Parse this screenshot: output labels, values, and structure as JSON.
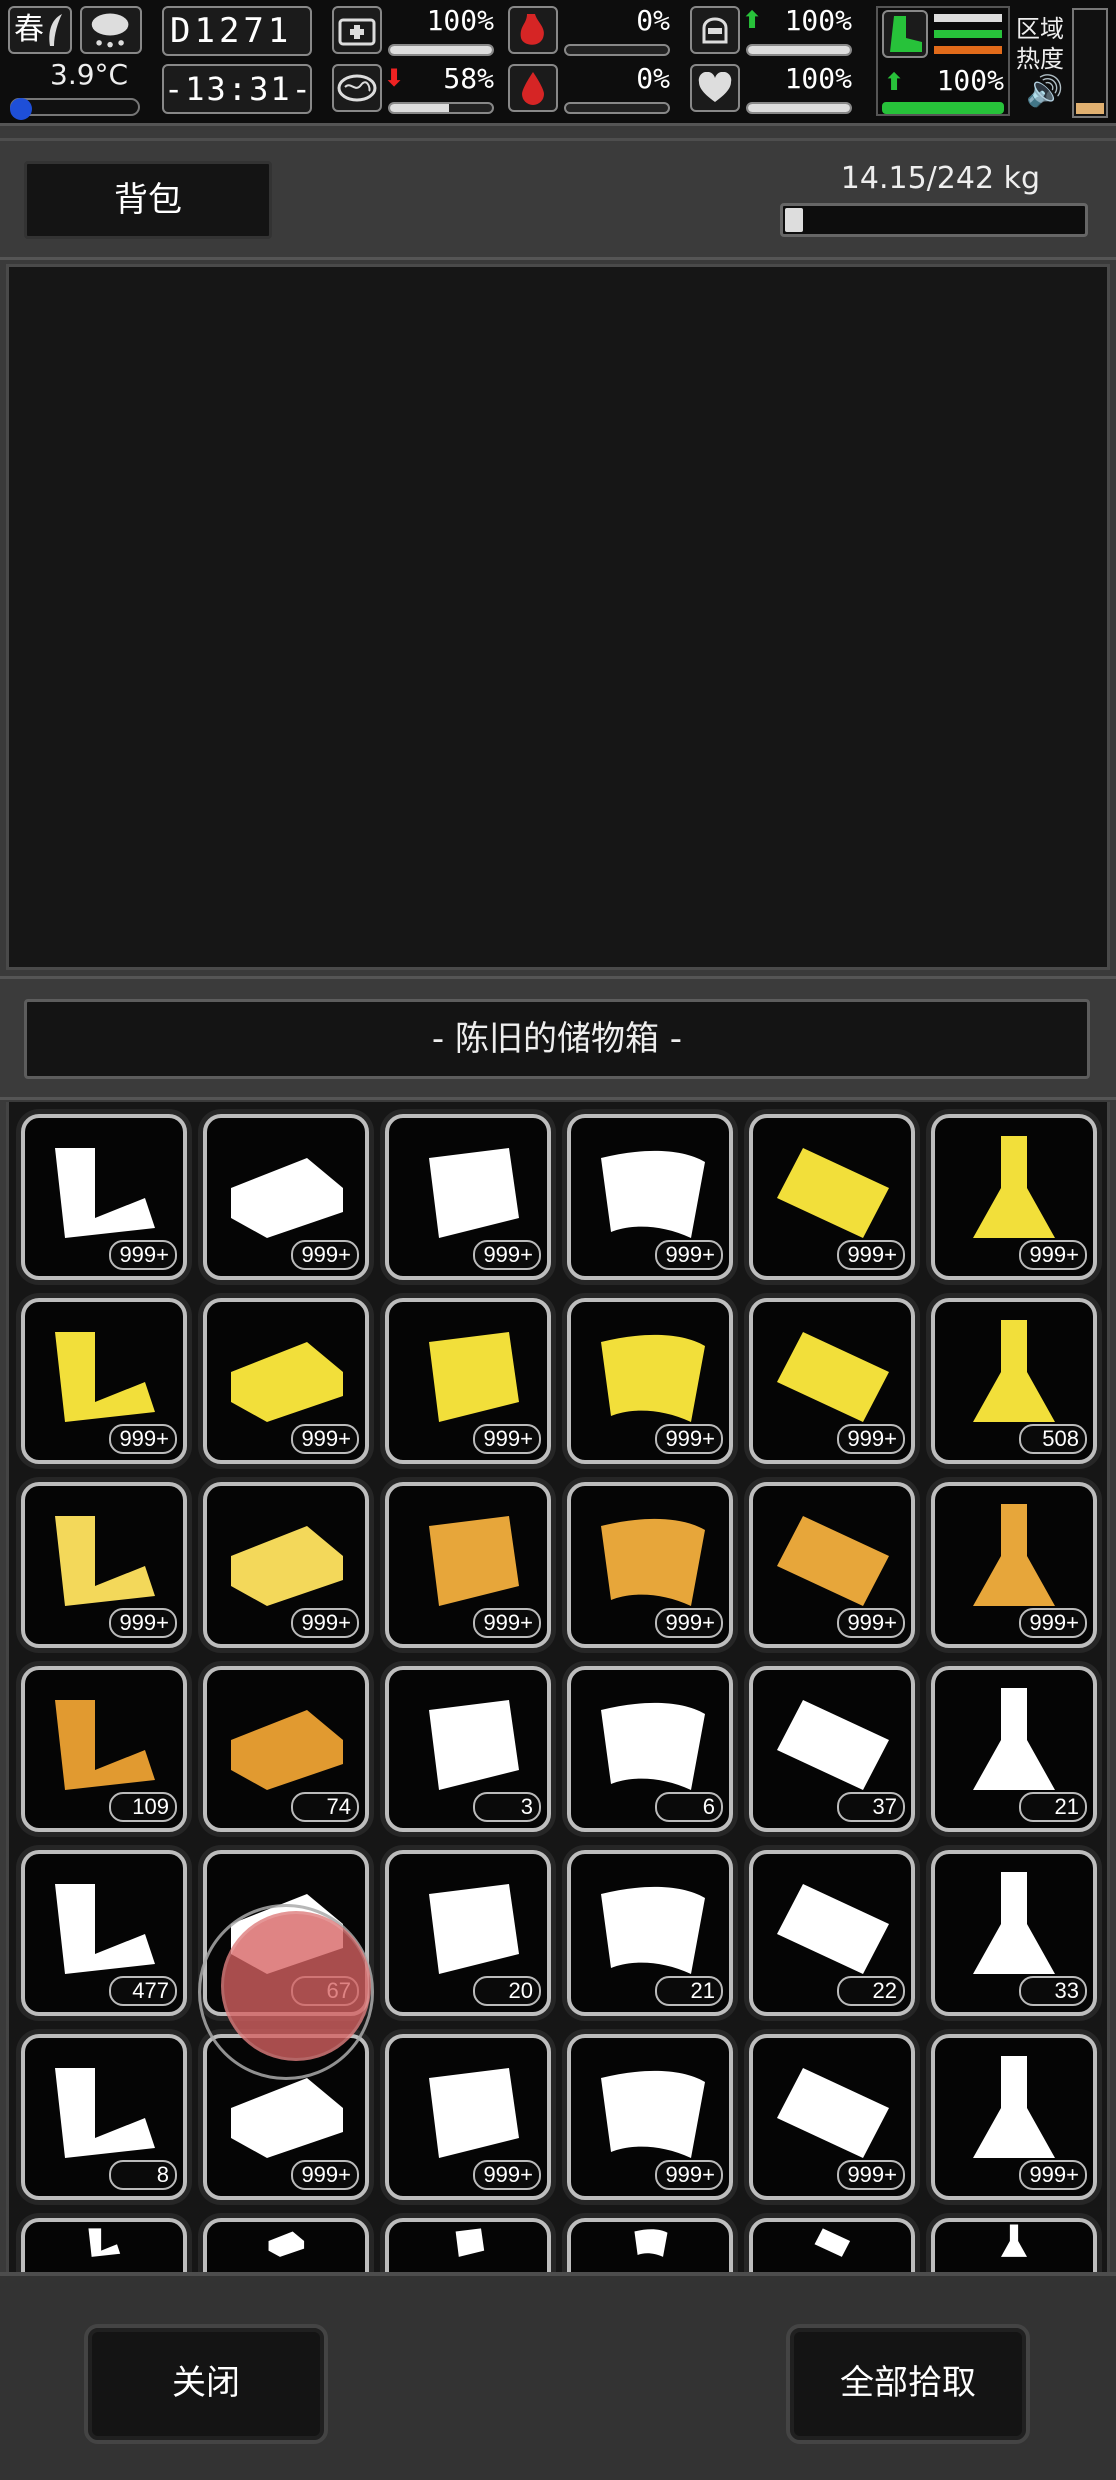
{
  "status": {
    "season": "春",
    "temperature": "3.9°C",
    "temperature_level": 0.0,
    "day": "D1271",
    "time": "-13:31-",
    "stats": [
      {
        "name": "health",
        "icon": "first-aid-icon",
        "value": "100%",
        "fill": 1.0
      },
      {
        "name": "hunger",
        "icon": "stomach-icon",
        "value": "0%",
        "fill": 0.0
      },
      {
        "name": "equipment",
        "icon": "helmet-icon",
        "value": "100%",
        "fill": 1.0
      },
      {
        "name": "mental",
        "icon": "brain-icon",
        "value": "58%",
        "fill": 0.58
      },
      {
        "name": "thirst",
        "icon": "blood-drop-icon",
        "value": "0%",
        "fill": 0.0
      },
      {
        "name": "heart",
        "icon": "heart-icon",
        "value": "100%",
        "fill": 1.0
      },
      {
        "name": "stamina",
        "icon": "boot-icon",
        "value": "100%",
        "fill": 1.0
      }
    ],
    "region_label": "区域\n热度",
    "heat_level": 0.1
  },
  "backpack": {
    "label": "背包",
    "weight_text": "14.15/242 kg",
    "weight_fraction": 0.058
  },
  "container": {
    "title": "- 陈旧的储物箱 -"
  },
  "items": [
    {
      "icon": "pipe-scraps-icon",
      "color": "#ffffff",
      "count": "999+"
    },
    {
      "icon": "metal-ingot-icon",
      "color": "#ffffff",
      "count": "999+"
    },
    {
      "icon": "metal-plate-icon",
      "color": "#ffffff",
      "count": "999+"
    },
    {
      "icon": "curved-sheet-icon",
      "color": "#ffffff",
      "count": "999+"
    },
    {
      "icon": "gold-plate-icon",
      "color": "#f2df3a",
      "count": "999+"
    },
    {
      "icon": "flask-icon",
      "color": "#f2df3a",
      "count": "999+"
    },
    {
      "icon": "wires-icon",
      "color": "#f2df3a",
      "count": "999+"
    },
    {
      "icon": "parts-icon",
      "color": "#f2df3a",
      "count": "999+"
    },
    {
      "icon": "gears-icon",
      "color": "#f2df3a",
      "count": "999+"
    },
    {
      "icon": "chips-icon",
      "color": "#f2df3a",
      "count": "999+"
    },
    {
      "icon": "spool-icon",
      "color": "#f2df3a",
      "count": "999+"
    },
    {
      "icon": "spring-icon",
      "color": "#f2df3a",
      "count": "508"
    },
    {
      "icon": "wood-planks-icon",
      "color": "#f3d85a",
      "count": "999+"
    },
    {
      "icon": "leather-icon",
      "color": "#f3d85a",
      "count": "999+"
    },
    {
      "icon": "thread-spool-icon",
      "color": "#e7a63a",
      "count": "999+"
    },
    {
      "icon": "rope-icon",
      "color": "#e7a63a",
      "count": "999+"
    },
    {
      "icon": "boards-icon",
      "color": "#e7a63a",
      "count": "999+"
    },
    {
      "icon": "potion-icon",
      "color": "#e7a63a",
      "count": "999+"
    },
    {
      "icon": "engine-icon",
      "color": "#e19a30",
      "count": "109"
    },
    {
      "icon": "cloth-bundle-icon",
      "color": "#e19a30",
      "count": "74"
    },
    {
      "icon": "fur-icon",
      "color": "#ffffff",
      "count": "3"
    },
    {
      "icon": "pelt-icon",
      "color": "#ffffff",
      "count": "6"
    },
    {
      "icon": "hide-icon",
      "color": "#ffffff",
      "count": "37"
    },
    {
      "icon": "fleece-icon",
      "color": "#ffffff",
      "count": "21"
    },
    {
      "icon": "vine-icon",
      "color": "#ffffff",
      "count": "477"
    },
    {
      "icon": "fern-icon",
      "color": "#ffffff",
      "count": "67"
    },
    {
      "icon": "filter-icon",
      "color": "#ffffff",
      "count": "20"
    },
    {
      "icon": "machine-part-icon",
      "color": "#ffffff",
      "count": "21"
    },
    {
      "icon": "battery-icon",
      "color": "#ffffff",
      "count": "22"
    },
    {
      "icon": "tool-icon",
      "color": "#ffffff",
      "count": "33"
    },
    {
      "icon": "pipe-icon",
      "color": "#ffffff",
      "count": "8"
    },
    {
      "icon": "rag-icon",
      "color": "#ffffff",
      "count": "999+"
    },
    {
      "icon": "towels-icon",
      "color": "#ffffff",
      "count": "999+"
    },
    {
      "icon": "fabric-icon",
      "color": "#ffffff",
      "count": "999+"
    },
    {
      "icon": "paper-roll-icon",
      "color": "#ffffff",
      "count": "999+"
    },
    {
      "icon": "sheets-icon",
      "color": "#ffffff",
      "count": "999+"
    },
    {
      "icon": "partial-item-icon",
      "color": "#ffffff",
      "count": ""
    },
    {
      "icon": "partial-item-icon",
      "color": "#ffffff",
      "count": ""
    },
    {
      "icon": "partial-item-icon",
      "color": "#ffffff",
      "count": ""
    },
    {
      "icon": "partial-item-icon",
      "color": "#ffffff",
      "count": ""
    },
    {
      "icon": "partial-item-icon",
      "color": "#ffffff",
      "count": ""
    },
    {
      "icon": "partial-item-icon",
      "color": "#ffffff",
      "count": ""
    }
  ],
  "footer": {
    "close_label": "关闭",
    "pickall_label": "全部拾取"
  }
}
